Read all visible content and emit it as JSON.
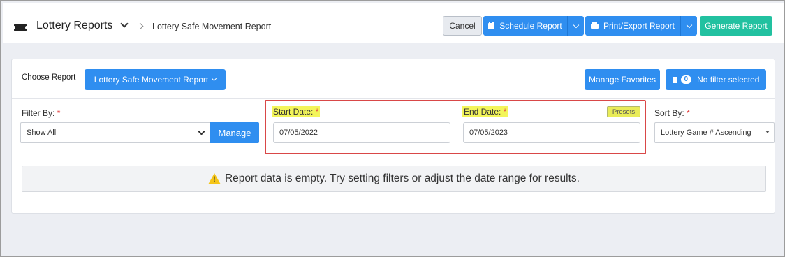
{
  "header": {
    "app_title": "Lottery Reports",
    "breadcrumb": "Lottery Safe Movement Report",
    "buttons": {
      "cancel": "Cancel",
      "schedule": "Schedule Report",
      "print_export": "Print/Export Report",
      "generate": "Generate Report"
    }
  },
  "report_bar": {
    "choose_label": "Choose Report",
    "selected_report": "Lottery Safe Movement Report",
    "manage_favorites": "Manage Favorites",
    "filter_count": "0",
    "filter_status": "No filter selected"
  },
  "filters": {
    "filter_by_label": "Filter By:",
    "filter_by_value": "Show All",
    "manage_button": "Manage",
    "start_date_label": "Start Date:",
    "start_date_value": "07/05/2022",
    "end_date_label": "End Date:",
    "end_date_value": "07/05/2023",
    "presets_button": "Presets",
    "sort_by_label": "Sort By:",
    "sort_by_value": "Lottery Game # Ascending",
    "required_marker": "*"
  },
  "alert": {
    "message": "Report data is empty. Try setting filters or adjust the date range for results."
  },
  "colors": {
    "primary": "#2f8ef0",
    "generate": "#22c1a0",
    "highlight": "#f3f55a",
    "required": "#e23a3a",
    "annotation_box": "#d94848"
  }
}
